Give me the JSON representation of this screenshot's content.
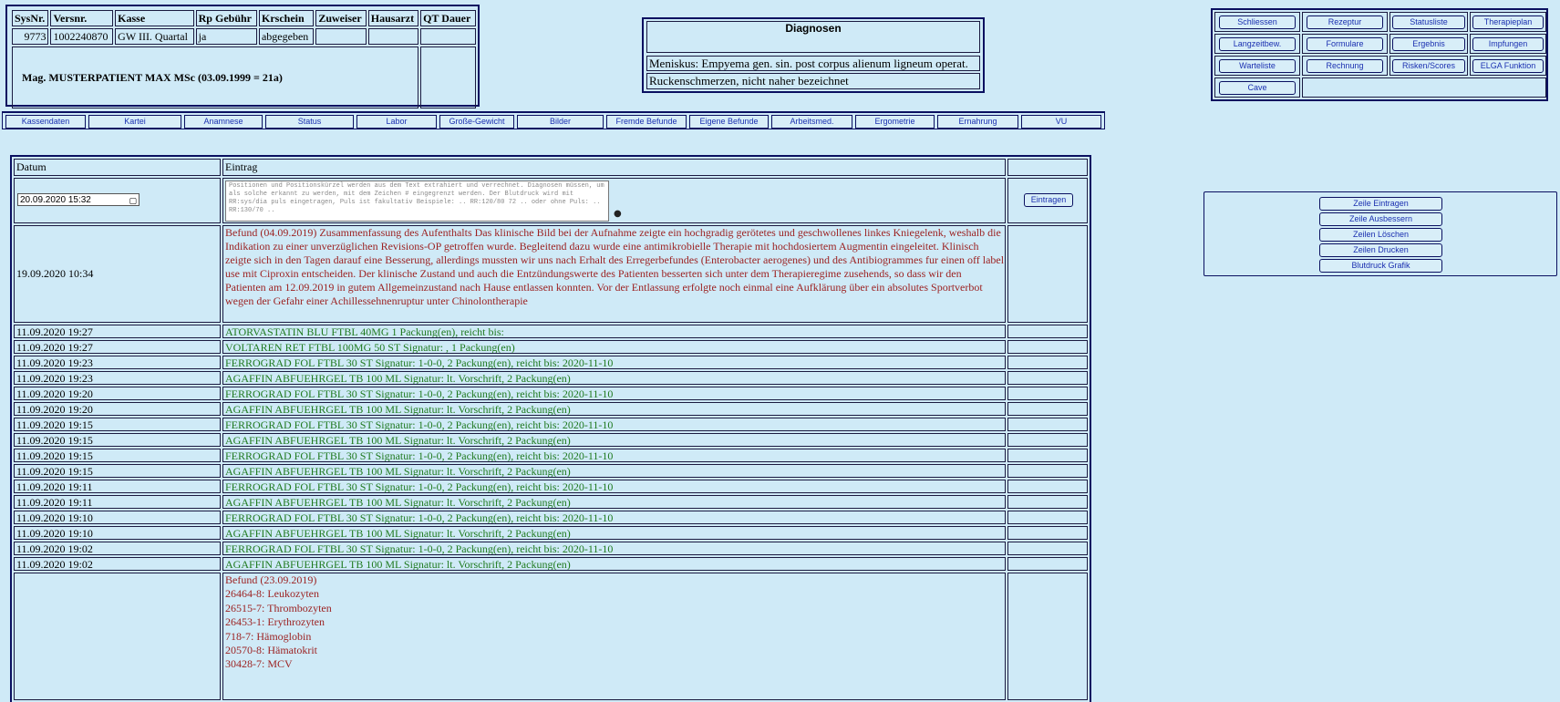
{
  "patient": {
    "headers": [
      "SysNr.",
      "Versnr.",
      "Kasse",
      "Rp Gebühr",
      "Krschein",
      "Zuweiser",
      "Hausarzt",
      "QT Dauer"
    ],
    "values": [
      "9773",
      "1002240870",
      "GW III. Quartal",
      "ja",
      "abgegeben",
      "",
      "",
      ""
    ],
    "name": "Mag. MUSTERPATIENT MAX MSc (03.09.1999 = 21a)"
  },
  "diagnoses": {
    "title": "Diagnosen",
    "items": [
      "Meniskus: Empyema gen. sin. post corpus alienum ligneum operat.",
      "Ruckenschmerzen, nicht naher bezeichnet"
    ]
  },
  "actions": [
    "Schliessen",
    "Rezeptur",
    "Statusliste",
    "Therapieplan",
    "Langzeitbew.",
    "Formulare",
    "Ergebnis",
    "Impfungen",
    "Warteliste",
    "Rechnung",
    "Risken/Scores",
    "ELGA Funktion",
    "Cave"
  ],
  "tabs": [
    "Kassendaten",
    "Kartei",
    "Anamnese",
    "Status",
    "Labor",
    "Große-Gewicht",
    "Bilder",
    "Fremde Befunde",
    "Eigene Befunde",
    "Arbeitsmed.",
    "Ergometrie",
    "Ernahrung",
    "VU"
  ],
  "row_actions": [
    "Zeile Eintragen",
    "Zeile Ausbessern",
    "Zeilen Löschen",
    "Zeilen Drucken",
    "Blutdruck Grafik"
  ],
  "table": {
    "col_date": "Datum",
    "col_entry": "Eintrag",
    "input_datetime": "20.09.2020 15:32",
    "textarea_placeholder": "Positionen und Positionskürzel werden aus dem Text extrahiert und verrechnet. Diagnosen müssen, um als solche erkannt zu werden, mit dem Zeichen # eingegrenzt werden. Der Blutdruck wird mit RR:sys/dia puls eingetragen, Puls ist fakultativ Beispiele: .. RR:120/80 72 .. oder ohne Puls: .. RR:130/70 ..",
    "submit_label": "Eintragen",
    "befund_date": "19.09.2020 10:34",
    "befund_text": "Befund (04.09.2019) Zusammenfassung des Aufenthalts Das klinische Bild bei der Aufnahme zeigte ein hochgradig gerötetes und geschwollenes linkes Kniegelenk, weshalb die Indikation zu einer unverzüglichen Revisions-OP getroffen wurde. Begleitend dazu wurde eine antimikrobielle Therapie mit hochdosiertem Augmentin eingeleitet. Klinisch zeigte sich in den Tagen darauf eine Besserung, allerdings mussten wir uns nach Erhalt des Erregerbefundes (Enterobacter aerogenes) und des Antibiogrammes fur einen off label use mit Ciproxin entscheiden. Der klinische Zustand und auch die Entzündungswerte des Patienten besserten sich unter dem Therapieregime zusehends, so dass wir den Patienten am 12.09.2019 in gutem Allgemeinzustand nach Hause entlassen konnten. Vor der Entlassung erfolgte noch einmal eine Aufklärung über ein absolutes Sportverbot wegen der Gefahr einer Achillessehnenruptur unter Chinolontherapie",
    "rows": [
      {
        "date": "11.09.2020 19:27",
        "text": "ATORVASTATIN BLU FTBL 40MG 1 Packung(en), reicht bis:"
      },
      {
        "date": "11.09.2020 19:27",
        "text": "VOLTAREN RET FTBL 100MG 50 ST Signatur: , 1 Packung(en)"
      },
      {
        "date": "11.09.2020 19:23",
        "text": "FERROGRAD FOL FTBL 30 ST Signatur: 1-0-0, 2 Packung(en), reicht bis: 2020-11-10"
      },
      {
        "date": "11.09.2020 19:23",
        "text": "AGAFFIN ABFUEHRGEL TB 100 ML Signatur: lt. Vorschrift, 2 Packung(en)"
      },
      {
        "date": "11.09.2020 19:20",
        "text": "FERROGRAD FOL FTBL 30 ST Signatur: 1-0-0, 2 Packung(en), reicht bis: 2020-11-10"
      },
      {
        "date": "11.09.2020 19:20",
        "text": "AGAFFIN ABFUEHRGEL TB 100 ML Signatur: lt. Vorschrift, 2 Packung(en)"
      },
      {
        "date": "11.09.2020 19:15",
        "text": "FERROGRAD FOL FTBL 30 ST Signatur: 1-0-0, 2 Packung(en), reicht bis: 2020-11-10"
      },
      {
        "date": "11.09.2020 19:15",
        "text": "AGAFFIN ABFUEHRGEL TB 100 ML Signatur: lt. Vorschrift, 2 Packung(en)"
      },
      {
        "date": "11.09.2020 19:15",
        "text": "FERROGRAD FOL FTBL 30 ST Signatur: 1-0-0, 2 Packung(en), reicht bis: 2020-11-10"
      },
      {
        "date": "11.09.2020 19:15",
        "text": "AGAFFIN ABFUEHRGEL TB 100 ML Signatur: lt. Vorschrift, 2 Packung(en)"
      },
      {
        "date": "11.09.2020 19:11",
        "text": "FERROGRAD FOL FTBL 30 ST Signatur: 1-0-0, 2 Packung(en), reicht bis: 2020-11-10"
      },
      {
        "date": "11.09.2020 19:11",
        "text": "AGAFFIN ABFUEHRGEL TB 100 ML Signatur: lt. Vorschrift, 2 Packung(en)"
      },
      {
        "date": "11.09.2020 19:10",
        "text": "FERROGRAD FOL FTBL 30 ST Signatur: 1-0-0, 2 Packung(en), reicht bis: 2020-11-10"
      },
      {
        "date": "11.09.2020 19:10",
        "text": "AGAFFIN ABFUEHRGEL TB 100 ML Signatur: lt. Vorschrift, 2 Packung(en)"
      },
      {
        "date": "11.09.2020 19:02",
        "text": "FERROGRAD FOL FTBL 30 ST Signatur: 1-0-0, 2 Packung(en), reicht bis: 2020-11-10"
      },
      {
        "date": "11.09.2020 19:02",
        "text": "AGAFFIN ABFUEHRGEL TB 100 ML Signatur: lt. Vorschrift, 2 Packung(en)"
      }
    ],
    "lab_text": "Befund (23.09.2019)\n26464-8: Leukozyten\n26515-7: Thrombozyten\n26453-1: Erythrozyten\n718-7: Hämoglobin\n20570-8: Hämatokrit\n30428-7: MCV"
  }
}
